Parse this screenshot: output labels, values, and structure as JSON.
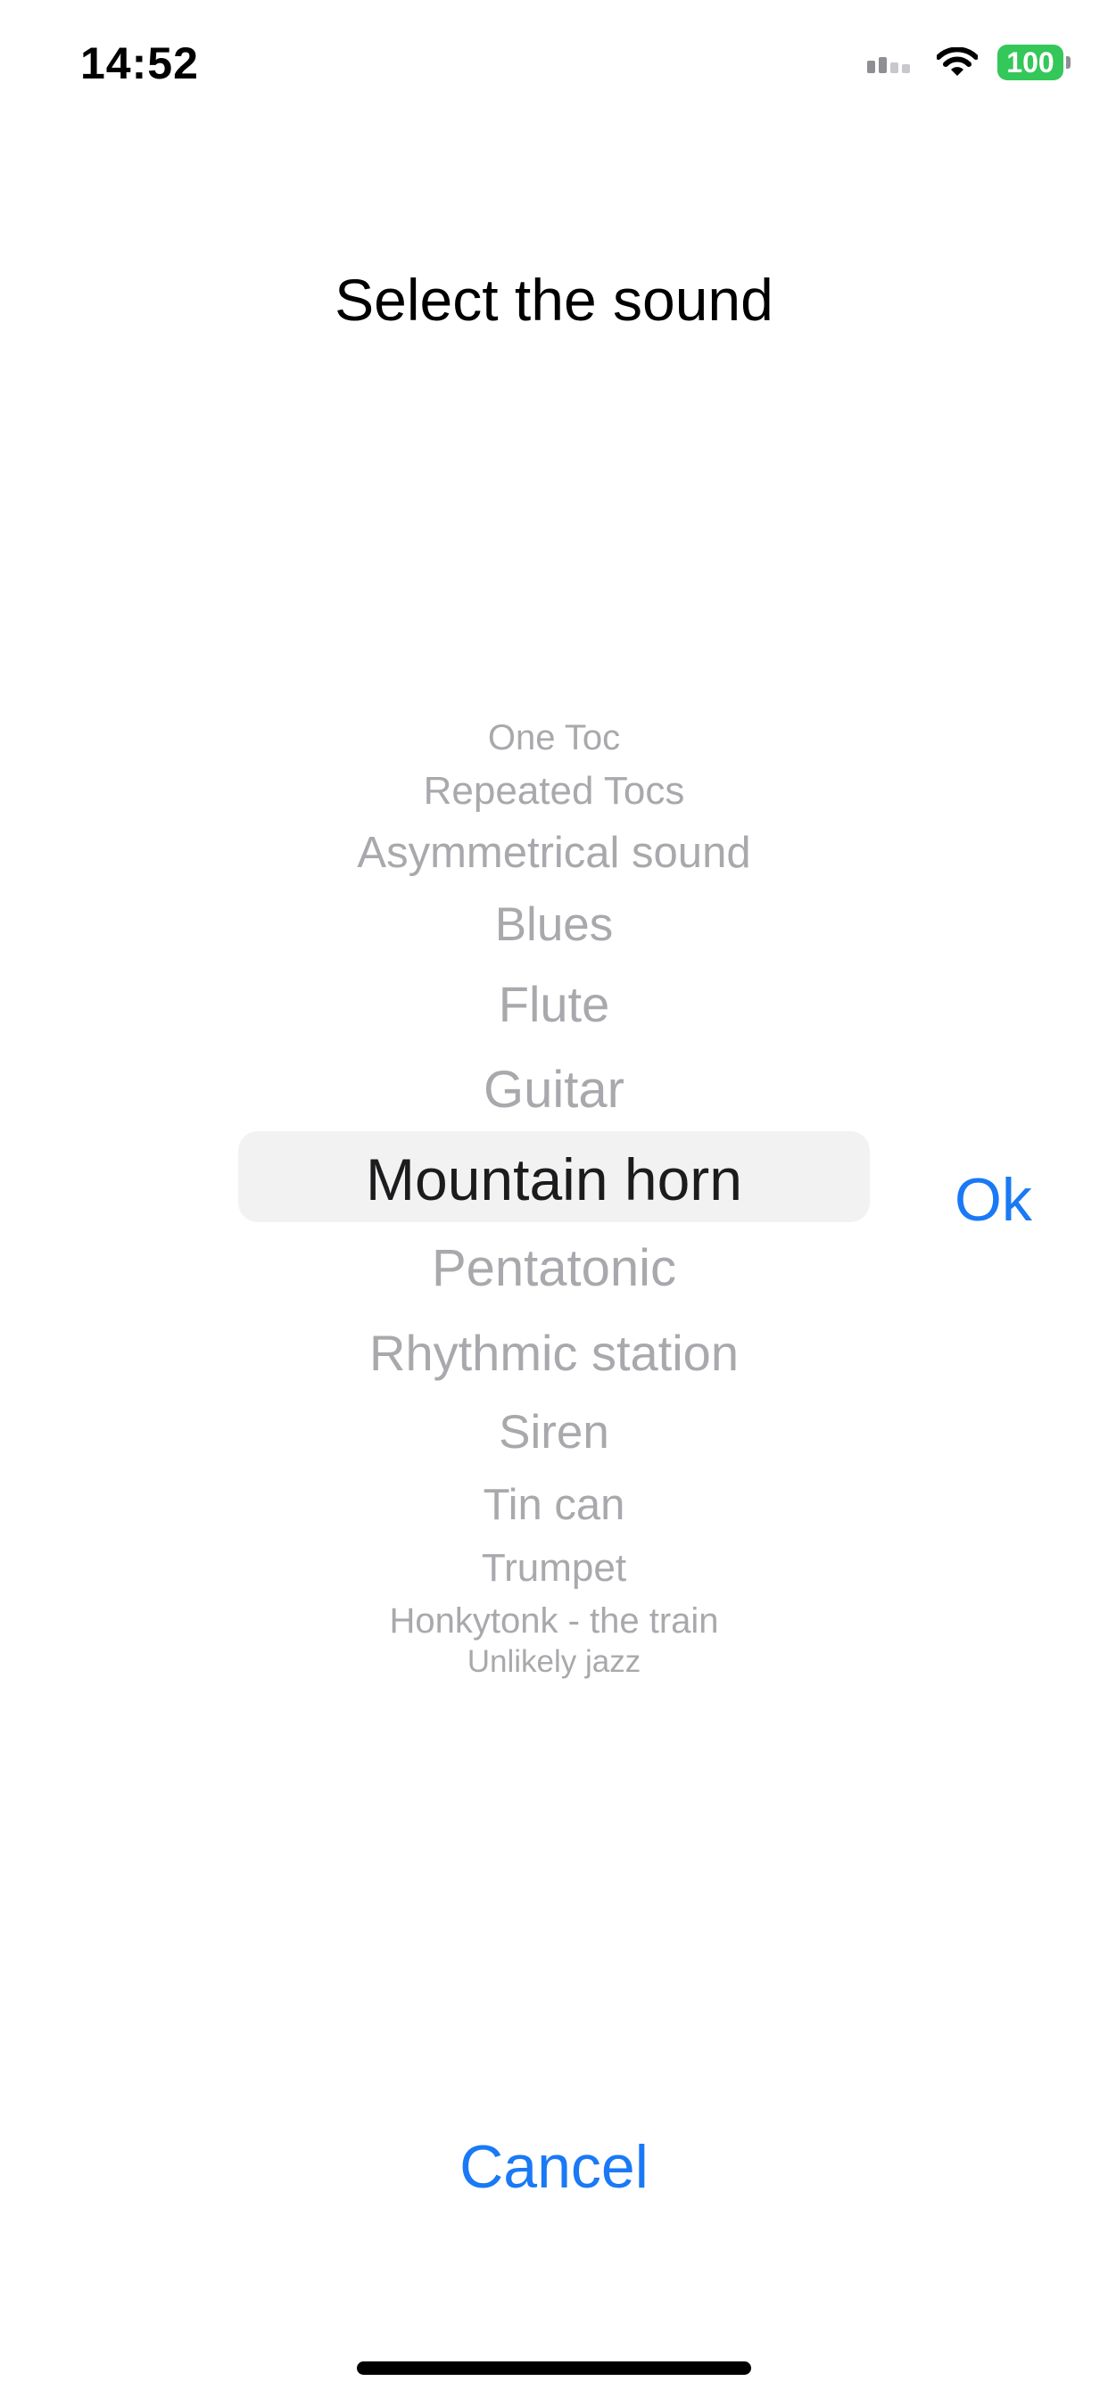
{
  "status_bar": {
    "time": "14:52",
    "battery": "100",
    "icons": [
      "signal-icon",
      "wifi-icon",
      "battery-icon"
    ],
    "battery_color": "#34c759"
  },
  "title": "Select the sound",
  "picker": {
    "selected": "Mountain horn",
    "items": [
      "One Toc",
      "Repeated Tocs",
      "Asymmetrical sound",
      "Blues",
      "Flute",
      "Guitar",
      "Mountain horn",
      "Pentatonic",
      "Rhythmic station",
      "Siren",
      "Tin can",
      "Trumpet",
      "Honkytonk - the train",
      "Unlikely jazz"
    ]
  },
  "buttons": {
    "ok": "Ok",
    "cancel": "Cancel"
  },
  "colors": {
    "accent": "#1a79f5",
    "picker_text": "#a9a9ad",
    "selected_text": "#1c1c1e",
    "highlight": "#f2f2f2"
  }
}
